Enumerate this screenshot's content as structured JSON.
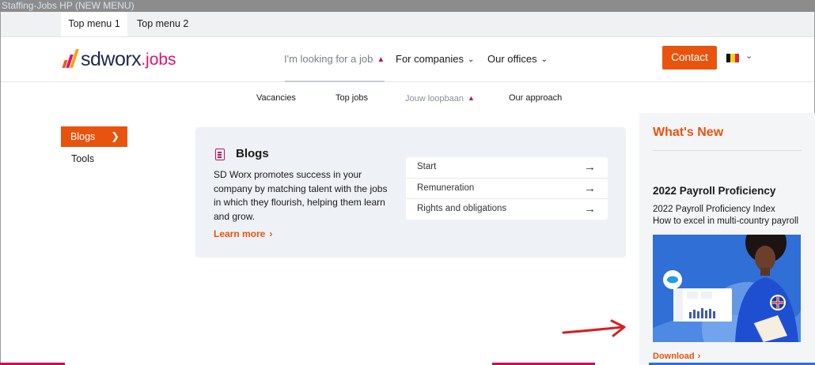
{
  "window": {
    "title": "Staffing-Jobs HP (NEW MENU)"
  },
  "top_menu": [
    "Top menu 1",
    "Top menu 2"
  ],
  "logo": {
    "word": "sdworx",
    "suffix": ".jobs"
  },
  "main_nav": {
    "looking": "I'm looking for a job",
    "companies": "For companies",
    "offices": "Our offices",
    "contact": "Contact",
    "language_flag": "belgium-flag"
  },
  "sub_nav": [
    "Vacancies",
    "Top jobs",
    "Jouw loopbaan",
    "Our approach"
  ],
  "left_menu": {
    "active": "Blogs",
    "other": "Tools"
  },
  "card": {
    "title": "Blogs",
    "description": "SD Worx promotes success in your company by matching talent with the jobs in which they flourish, helping them learn and grow.",
    "learn_more": "Learn more",
    "links": [
      "Start",
      "Remuneration",
      "Rights and obligations"
    ]
  },
  "whats_new": {
    "title": "What's New",
    "heading": "2022 Payroll Proficiency",
    "line1": "2022 Payroll Proficiency Index",
    "line2": "How to excel in multi-country payroll",
    "download": "Download"
  },
  "colors": {
    "accent_orange": "#e8540e",
    "brand_magenta": "#c80d5b",
    "annotation_red": "#d42020"
  }
}
